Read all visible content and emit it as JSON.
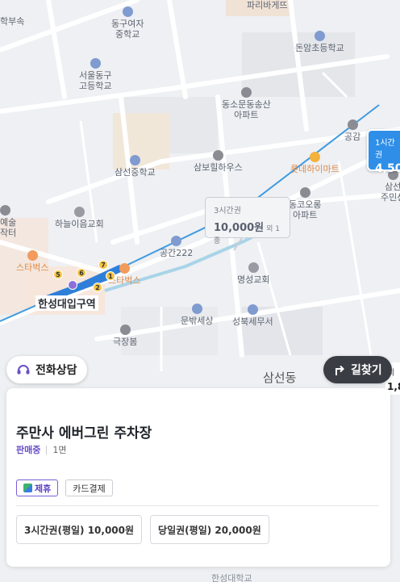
{
  "map": {
    "pois": [
      {
        "name": "파리바게뜨",
        "type": "cafe"
      },
      {
        "name": "동구여자\n중학교",
        "type": "school"
      },
      {
        "name": "돈암초등학교",
        "type": "school"
      },
      {
        "name": "서울동구\n고등학교",
        "type": "school"
      },
      {
        "name": "동소문동송산\n아파트",
        "type": "building"
      },
      {
        "name": "삼선중학교",
        "type": "school"
      },
      {
        "name": "삼보힐하우스",
        "type": "building"
      },
      {
        "name": "롯데하이마트",
        "type": "shop"
      },
      {
        "name": "공감",
        "type": "building"
      },
      {
        "name": "삼선\n주민센",
        "type": "building"
      },
      {
        "name": "동코오롱\n아파트",
        "type": "building"
      },
      {
        "name": "하늘이음교회",
        "type": "church"
      },
      {
        "name": "공간222",
        "type": "building"
      },
      {
        "name": "명성교회",
        "type": "church"
      },
      {
        "name": "스타벅스",
        "type": "cafe"
      },
      {
        "name": "스타벅스",
        "type": "cafe"
      },
      {
        "name": "문밖세상",
        "type": "school"
      },
      {
        "name": "성북세무서",
        "type": "school"
      },
      {
        "name": "극장봄",
        "type": "building"
      },
      {
        "name": "예술\n작터",
        "type": "building"
      },
      {
        "name": "학부속",
        "type": "school"
      },
      {
        "name": "삼선동",
        "type": "area"
      }
    ],
    "station": {
      "name": "한성대입구역",
      "exits": [
        "1",
        "2",
        "5",
        "6",
        "7"
      ]
    },
    "price_bubble": {
      "ticket": "3시간권",
      "price": "10,000원",
      "extra": "외 1종"
    },
    "blue_marker": {
      "ticket": "1시간권",
      "price": "4,50"
    },
    "right_peek": {
      "label": "시",
      "price": "1,8"
    }
  },
  "actions": {
    "call_label": "전화상담",
    "route_label": "길찾기"
  },
  "sheet": {
    "title": "주만사 에버그린 주차장",
    "status": "판매중",
    "spaces": "1면",
    "tags": [
      "제휴",
      "카드결제"
    ],
    "tickets": [
      "3시간권(평일) 10,000원",
      "당일권(평일) 20,000원"
    ]
  },
  "bottom": {
    "label": "한성대학교"
  },
  "colors": {
    "accent_purple": "#6a4fc7",
    "marker_blue": "#2e8ee8",
    "route_dark": "#3a3d44"
  }
}
